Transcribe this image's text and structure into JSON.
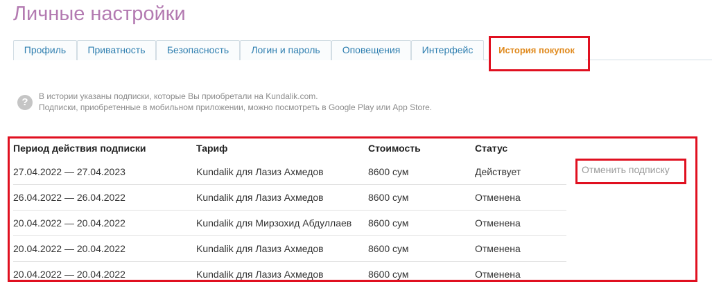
{
  "page": {
    "title": "Личные настройки"
  },
  "tabs": [
    {
      "label": "Профиль"
    },
    {
      "label": "Приватность"
    },
    {
      "label": "Безопасность"
    },
    {
      "label": "Логин и пароль"
    },
    {
      "label": "Оповещения"
    },
    {
      "label": "Интерфейс"
    },
    {
      "label": "История покупок",
      "active": true
    }
  ],
  "info": {
    "icon": "question-icon",
    "line1": "В истории указаны подписки, которые Вы приобретали на Kundalik.com.",
    "line2": "Подписки, приобретенные в мобильном приложении, можно посмотреть в Google Play или App Store."
  },
  "table": {
    "headers": {
      "period": "Период действия подписки",
      "tariff": "Тариф",
      "price": "Стоимость",
      "status": "Статус"
    },
    "rows": [
      {
        "period": "27.04.2022 — 27.04.2023",
        "tariff": "Kundalik для Лазиз Ахмедов",
        "price": "8600 сум",
        "status": "Действует"
      },
      {
        "period": "26.04.2022 — 26.04.2022",
        "tariff": "Kundalik для Лазиз Ахмедов",
        "price": "8600 сум",
        "status": "Отменена"
      },
      {
        "period": "20.04.2022 — 20.04.2022",
        "tariff": "Kundalik для Мирзохид Абдуллаев",
        "price": "8600 сум",
        "status": "Отменена"
      },
      {
        "period": "20.04.2022 — 20.04.2022",
        "tariff": "Kundalik для Лазиз Ахмедов",
        "price": "8600 сум",
        "status": "Отменена"
      },
      {
        "period": "20.04.2022 — 20.04.2022",
        "tariff": "Kundalik для Лазиз Ахмедов",
        "price": "8600 сум",
        "status": "Отменена"
      }
    ],
    "cancel_label": "Отменить подписку"
  },
  "colors": {
    "title": "#b37ab1",
    "tab_link": "#2f7fb0",
    "tab_active": "#e08a1e",
    "highlight": "#e01020"
  }
}
